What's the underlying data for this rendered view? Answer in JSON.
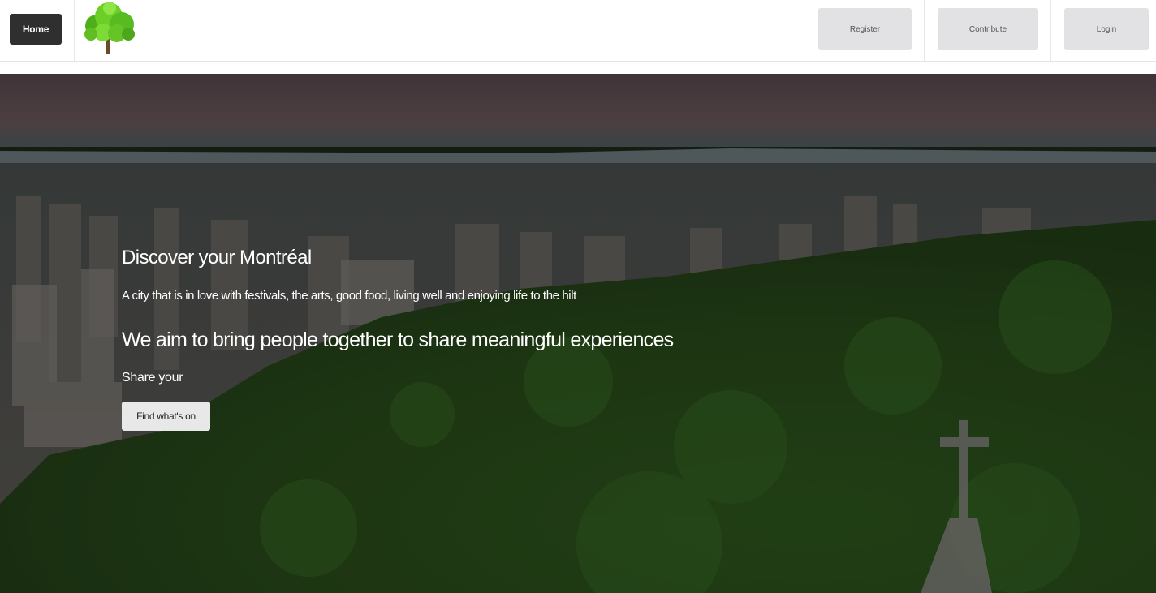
{
  "nav": {
    "home_label": "Home",
    "register_label": "Register",
    "contribute_label": "Contribute",
    "login_label": "Login"
  },
  "hero": {
    "title": "Discover your Montréal",
    "tagline": "A city that is in love with festivals, the arts, good food, living well and enjoying life to the hilt",
    "aim": "We aim to bring people together to share meaningful experiences",
    "share_text": "Share your",
    "cta_label": "Find what's on"
  },
  "icons": {
    "logo": "tree-logo-icon"
  },
  "colors": {
    "home_button": "#2f2f2f",
    "nav_button": "#e2e2e4",
    "cta_button": "#e8e8e8",
    "hero_text": "#ffffff",
    "logo_foliage": "#5cc21f"
  }
}
